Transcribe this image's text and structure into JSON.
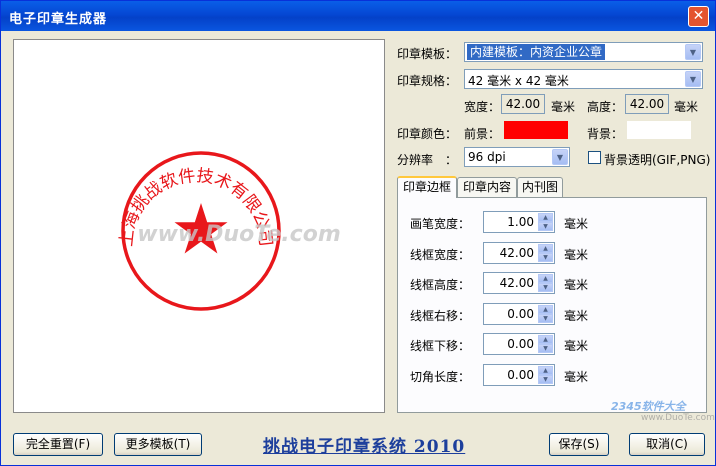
{
  "window": {
    "title": "电子印章生成器",
    "close_glyph": "✕"
  },
  "stamp": {
    "text": "上海挑战软件技术有限公司",
    "color": "#e8171b",
    "watermark": "www.DuoTe.com"
  },
  "form": {
    "template_label": "印章模板：",
    "template_value": "内建模板：内资企业公章",
    "size_label": "印章规格：",
    "size_value": "42 毫米  x  42 毫米",
    "width_label": "宽度：",
    "width_value": "42.00",
    "width_unit": "毫米",
    "height_label": "高度：",
    "height_value": "42.00",
    "height_unit": "毫米",
    "color_label": "印章颜色：",
    "foreground_label": "前景：",
    "foreground_color": "#ff0000",
    "background_label": "背景：",
    "background_color": "#ffffff",
    "resolution_label": "分辨率",
    "resolution_colon": "：",
    "resolution_value": "96 dpi",
    "transparent_label": "背景透明(GIF,PNG)"
  },
  "tabs": [
    {
      "label": "印章边框",
      "active": true
    },
    {
      "label": "印章内容",
      "active": false
    },
    {
      "label": "内刊图",
      "active": false
    }
  ],
  "border_settings": [
    {
      "label": "画笔宽度：",
      "value": "1.00",
      "unit": "毫米"
    },
    {
      "label": "线框宽度：",
      "value": "42.00",
      "unit": "毫米"
    },
    {
      "label": "线框高度：",
      "value": "42.00",
      "unit": "毫米"
    },
    {
      "label": "线框右移：",
      "value": "0.00",
      "unit": "毫米"
    },
    {
      "label": "线框下移：",
      "value": "0.00",
      "unit": "毫米"
    },
    {
      "label": "切角长度：",
      "value": "0.00",
      "unit": "毫米"
    }
  ],
  "footer": {
    "reset_label": "完全重置(F)",
    "more_templates_label": "更多模板(T)",
    "app_name": "挑战电子印章系统 2010",
    "save_label": "保存(S)",
    "cancel_label": "取消(C)",
    "watermark_logo": "2345软件大全",
    "watermark_site": "www.DuoTe.com"
  }
}
